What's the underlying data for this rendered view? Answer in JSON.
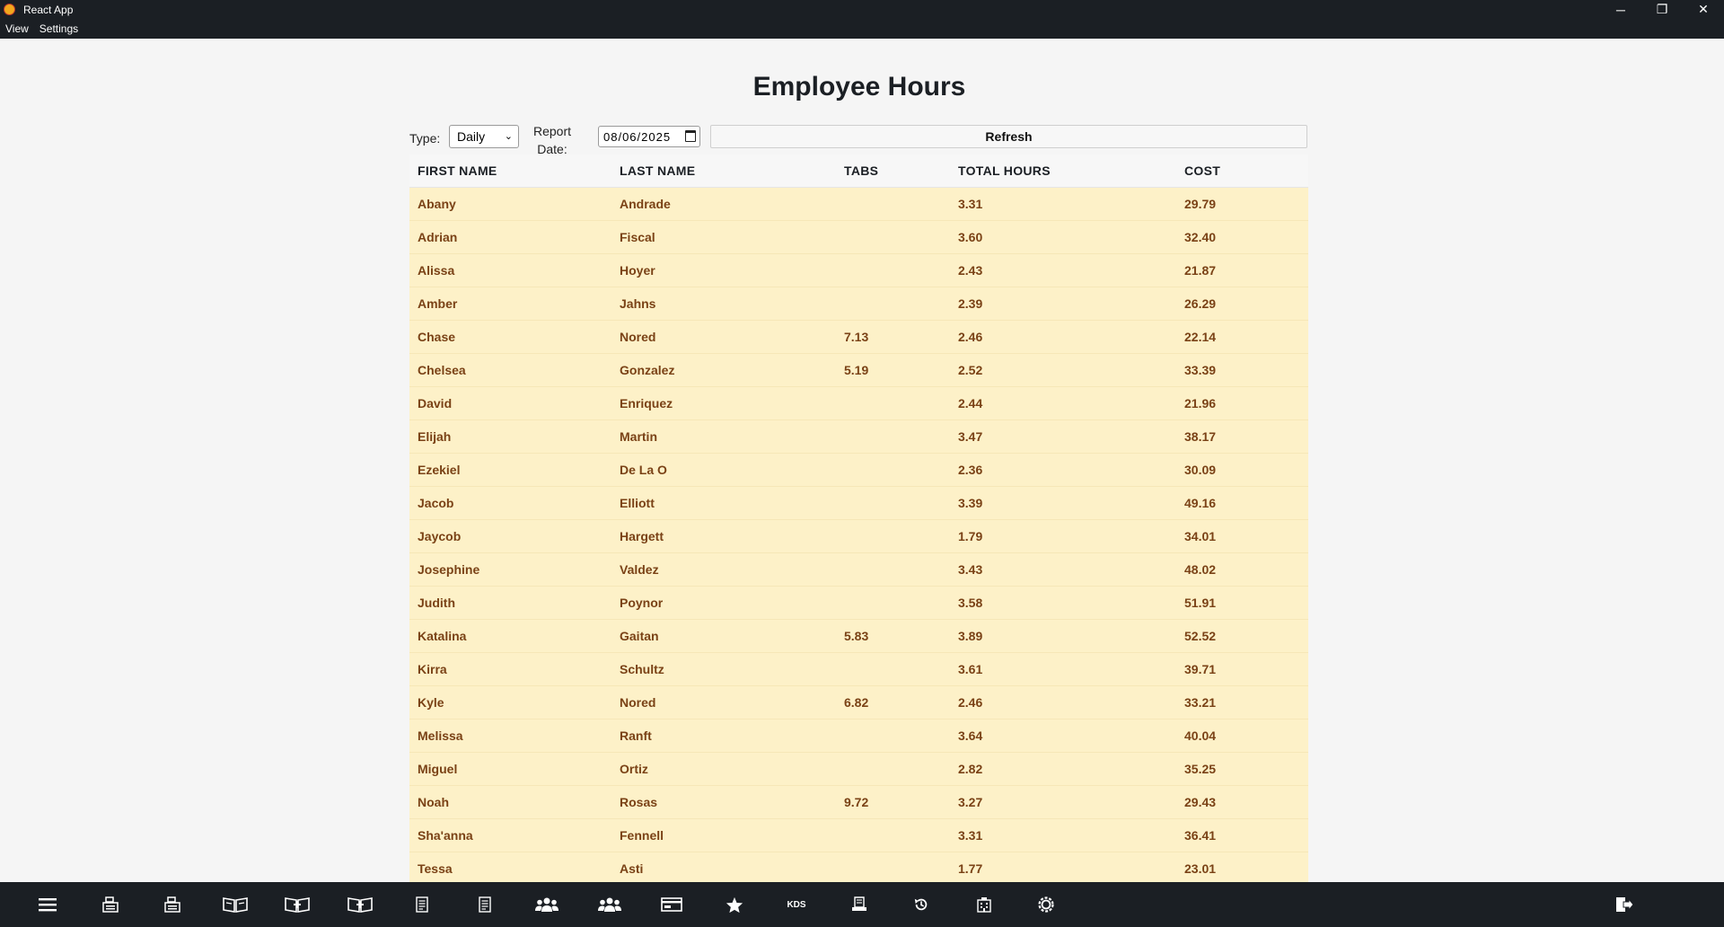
{
  "window": {
    "title": "React App",
    "minimize": "─",
    "maximize": "❐",
    "close": "✕"
  },
  "menu": {
    "items": [
      {
        "label": "View"
      },
      {
        "label": "Settings"
      }
    ]
  },
  "page": {
    "title": "Employee Hours"
  },
  "filters": {
    "type_label": "Type:",
    "type_value": "Daily",
    "report_date_label_line1": "Report",
    "report_date_label_line2": "Date:",
    "report_date_value": "08/06/2025",
    "refresh_label": "Refresh"
  },
  "table": {
    "headers": [
      "FIRST NAME",
      "LAST NAME",
      "TABS",
      "TOTAL HOURS",
      "COST"
    ],
    "rows": [
      [
        "Abany",
        "Andrade",
        "",
        "3.31",
        "29.79"
      ],
      [
        "Adrian",
        "Fiscal",
        "",
        "3.60",
        "32.40"
      ],
      [
        "Alissa",
        "Hoyer",
        "",
        "2.43",
        "21.87"
      ],
      [
        "Amber",
        "Jahns",
        "",
        "2.39",
        "26.29"
      ],
      [
        "Chase",
        "Nored",
        "7.13",
        "2.46",
        "22.14"
      ],
      [
        "Chelsea",
        "Gonzalez",
        "5.19",
        "2.52",
        "33.39"
      ],
      [
        "David",
        "Enriquez",
        "",
        "2.44",
        "21.96"
      ],
      [
        "Elijah",
        "Martin",
        "",
        "3.47",
        "38.17"
      ],
      [
        "Ezekiel",
        "De La O",
        "",
        "2.36",
        "30.09"
      ],
      [
        "Jacob",
        "Elliott",
        "",
        "3.39",
        "49.16"
      ],
      [
        "Jaycob",
        "Hargett",
        "",
        "1.79",
        "34.01"
      ],
      [
        "Josephine",
        "Valdez",
        "",
        "3.43",
        "48.02"
      ],
      [
        "Judith",
        "Poynor",
        "",
        "3.58",
        "51.91"
      ],
      [
        "Katalina",
        "Gaitan",
        "5.83",
        "3.89",
        "52.52"
      ],
      [
        "Kirra",
        "Schultz",
        "",
        "3.61",
        "39.71"
      ],
      [
        "Kyle",
        "Nored",
        "6.82",
        "2.46",
        "33.21"
      ],
      [
        "Melissa",
        "Ranft",
        "",
        "3.64",
        "40.04"
      ],
      [
        "Miguel",
        "Ortiz",
        "",
        "2.82",
        "35.25"
      ],
      [
        "Noah",
        "Rosas",
        "9.72",
        "3.27",
        "29.43"
      ],
      [
        "Sha'anna",
        "Fennell",
        "",
        "3.31",
        "36.41"
      ],
      [
        "Tessa",
        "Asti",
        "",
        "1.77",
        "23.01"
      ]
    ]
  },
  "toolbar": {
    "kds_label": "KDS",
    "icons": [
      "menu-icon",
      "register-icon",
      "register-2-icon",
      "open-book-icon",
      "add-book-icon",
      "add-book-2-icon",
      "document-icon",
      "document-2-icon",
      "group-icon",
      "group-2-icon",
      "card-icon",
      "star-icon",
      "kds-icon",
      "receipt-icon",
      "history-icon",
      "building-icon",
      "settings-icon",
      "logout-icon"
    ]
  },
  "colors": {
    "chrome": "#1b1f24",
    "row_bg": "#fdf1c8",
    "row_text": "#7a4216"
  }
}
